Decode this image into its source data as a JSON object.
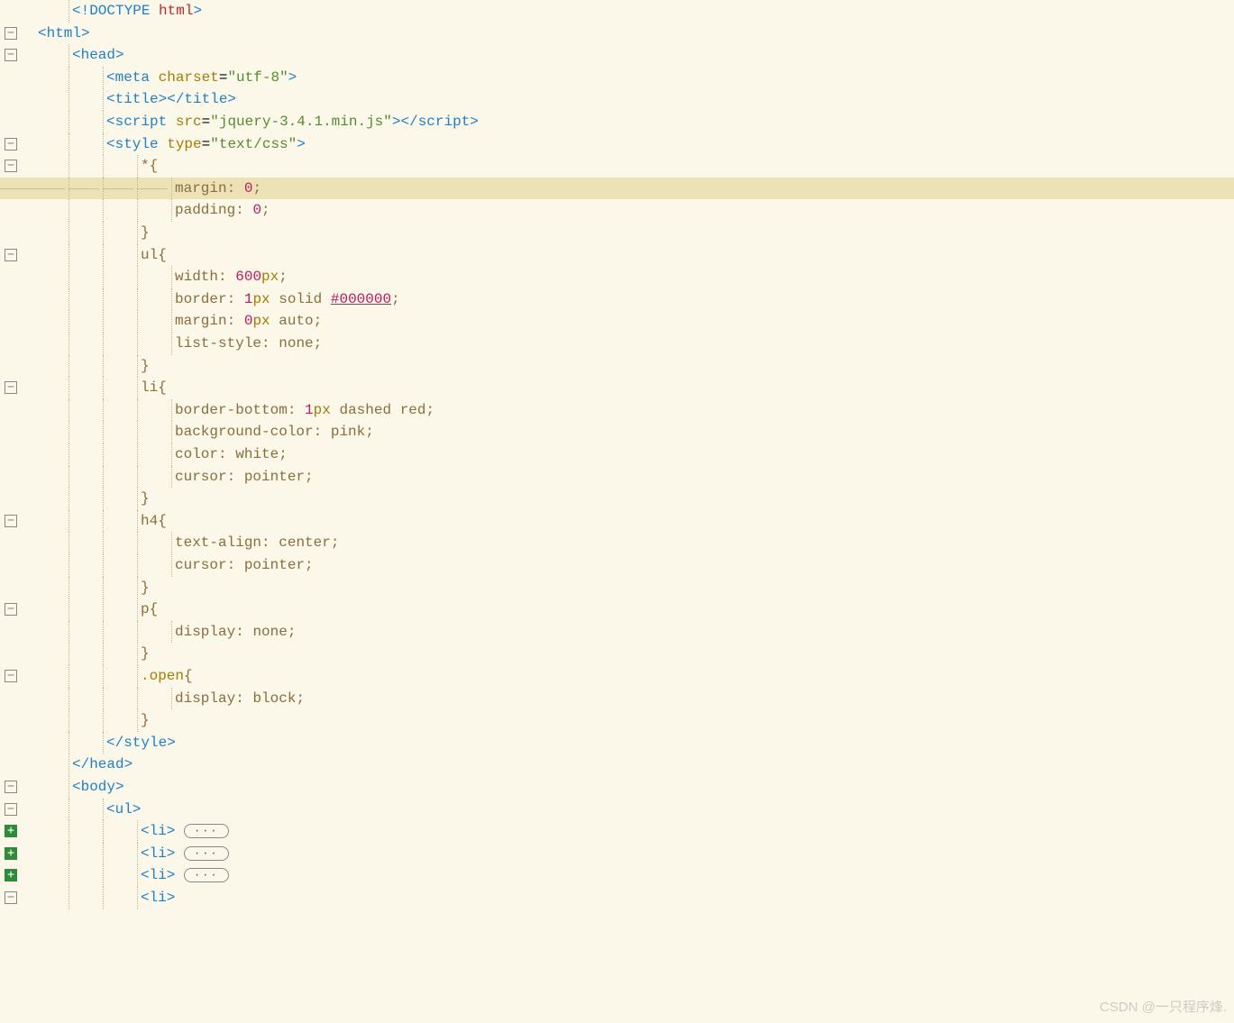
{
  "watermark": "CSDN @一只程序烽.",
  "pill": "···",
  "lines": [
    {
      "fold": null,
      "indent": 1,
      "html": "<span class='t-tag'>&lt;!DOCTYPE</span> <span class='t-red'>html</span><span class='t-tag'>&gt;</span>"
    },
    {
      "fold": "minus",
      "indent": 0,
      "html": "<span class='t-tag'>&lt;html&gt;</span>"
    },
    {
      "fold": "minus",
      "indent": 1,
      "html": "<span class='t-tag'>&lt;head&gt;</span>"
    },
    {
      "fold": null,
      "indent": 2,
      "html": "<span class='t-tag'>&lt;meta</span> <span class='t-attr'>charset</span>=<span class='t-str'>\"utf-8\"</span><span class='t-tag'>&gt;</span>"
    },
    {
      "fold": null,
      "indent": 2,
      "html": "<span class='t-tag'>&lt;title&gt;&lt;/title&gt;</span>"
    },
    {
      "fold": null,
      "indent": 2,
      "html": "<span class='t-tag'>&lt;script</span> <span class='t-attr'>src</span>=<span class='t-str'>\"jquery-3.4.1.min.js\"</span><span class='t-tag'>&gt;&lt;/script&gt;</span>"
    },
    {
      "fold": "minus",
      "indent": 2,
      "html": "<span class='t-tag'>&lt;style</span> <span class='t-attr'>type</span>=<span class='t-str'>\"text/css\"</span><span class='t-tag'>&gt;</span>"
    },
    {
      "fold": "minus",
      "indent": 3,
      "html": "<span class='t-sel'>*</span><span class='t-punc'>{</span>"
    },
    {
      "fold": null,
      "indent": 4,
      "hl": true,
      "hlguides": true,
      "html": "<span class='t-prop'>margin</span><span class='t-punc'>:</span> <span class='t-num'>0</span><span class='t-punc'>;</span>"
    },
    {
      "fold": null,
      "indent": 4,
      "html": "<span class='t-prop'>padding</span><span class='t-punc'>:</span> <span class='t-num'>0</span><span class='t-punc'>;</span>"
    },
    {
      "fold": null,
      "indent": 3,
      "html": "<span class='t-punc'>}</span>"
    },
    {
      "fold": "minus",
      "indent": 3,
      "html": "<span class='t-sel'>ul</span><span class='t-punc'>{</span>"
    },
    {
      "fold": null,
      "indent": 4,
      "html": "<span class='t-prop'>width</span><span class='t-punc'>:</span> <span class='t-num'>600</span><span class='t-kw'>px</span><span class='t-punc'>;</span>"
    },
    {
      "fold": null,
      "indent": 4,
      "html": "<span class='t-prop'>border</span><span class='t-punc'>:</span> <span class='t-num'>1</span><span class='t-kw'>px</span> <span class='t-val'>solid</span> <span class='t-hex'>#000000</span><span class='t-punc'>;</span>"
    },
    {
      "fold": null,
      "indent": 4,
      "html": "<span class='t-prop'>margin</span><span class='t-punc'>:</span> <span class='t-num'>0</span><span class='t-kw'>px</span> <span class='t-val'>auto</span><span class='t-punc'>;</span>"
    },
    {
      "fold": null,
      "indent": 4,
      "html": "<span class='t-prop'>list-style</span><span class='t-punc'>:</span> <span class='t-val'>none</span><span class='t-punc'>;</span>"
    },
    {
      "fold": null,
      "indent": 3,
      "html": "<span class='t-punc'>}</span>"
    },
    {
      "fold": "minus",
      "indent": 3,
      "html": "<span class='t-sel'>li</span><span class='t-punc'>{</span>"
    },
    {
      "fold": null,
      "indent": 4,
      "html": "<span class='t-prop'>border-bottom</span><span class='t-punc'>:</span> <span class='t-num'>1</span><span class='t-kw'>px</span> <span class='t-val'>dashed</span> <span class='t-val'>red</span><span class='t-punc'>;</span>"
    },
    {
      "fold": null,
      "indent": 4,
      "html": "<span class='t-prop'>background-color</span><span class='t-punc'>:</span> <span class='t-val'>pink</span><span class='t-punc'>;</span>"
    },
    {
      "fold": null,
      "indent": 4,
      "html": "<span class='t-prop'>color</span><span class='t-punc'>:</span> <span class='t-val'>white</span><span class='t-punc'>;</span>"
    },
    {
      "fold": null,
      "indent": 4,
      "html": "<span class='t-prop'>cursor</span><span class='t-punc'>:</span> <span class='t-val'>pointer</span><span class='t-punc'>;</span>"
    },
    {
      "fold": null,
      "indent": 3,
      "html": "<span class='t-punc'>}</span>"
    },
    {
      "fold": "minus",
      "indent": 3,
      "html": "<span class='t-sel'>h4</span><span class='t-punc'>{</span>"
    },
    {
      "fold": null,
      "indent": 4,
      "html": "<span class='t-prop'>text-align</span><span class='t-punc'>:</span> <span class='t-val'>center</span><span class='t-punc'>;</span>"
    },
    {
      "fold": null,
      "indent": 4,
      "html": "<span class='t-prop'>cursor</span><span class='t-punc'>:</span> <span class='t-val'>pointer</span><span class='t-punc'>;</span>"
    },
    {
      "fold": null,
      "indent": 3,
      "html": "<span class='t-punc'>}</span>"
    },
    {
      "fold": "minus",
      "indent": 3,
      "html": "<span class='t-sel'>p</span><span class='t-punc'>{</span>"
    },
    {
      "fold": null,
      "indent": 4,
      "html": "<span class='t-prop'>display</span><span class='t-punc'>:</span> <span class='t-val'>none</span><span class='t-punc'>;</span>"
    },
    {
      "fold": null,
      "indent": 3,
      "html": "<span class='t-punc'>}</span>"
    },
    {
      "fold": "minus",
      "indent": 3,
      "html": "<span class='t-class'>.open</span><span class='t-punc'>{</span>"
    },
    {
      "fold": null,
      "indent": 4,
      "html": "<span class='t-prop'>display</span><span class='t-punc'>:</span> <span class='t-val'>block</span><span class='t-punc'>;</span>"
    },
    {
      "fold": null,
      "indent": 3,
      "html": "<span class='t-punc'>}</span>"
    },
    {
      "fold": null,
      "indent": 2,
      "html": "<span class='t-tag'>&lt;/style&gt;</span>"
    },
    {
      "fold": null,
      "indent": 1,
      "html": "<span class='t-tag'>&lt;/head&gt;</span>"
    },
    {
      "fold": "minus",
      "indent": 1,
      "html": "<span class='t-tag'>&lt;body&gt;</span>"
    },
    {
      "fold": "minus",
      "indent": 2,
      "html": "<span class='t-tag'>&lt;ul&gt;</span>"
    },
    {
      "fold": "plus",
      "indent": 3,
      "html": "<span class='t-tag'>&lt;li&gt;</span> <span class='fold-pill' data-name='folded-code-pill' data-interactable='true' data-bind='pill'></span>"
    },
    {
      "fold": "plus",
      "indent": 3,
      "html": "<span class='t-tag'>&lt;li&gt;</span> <span class='fold-pill' data-name='folded-code-pill' data-interactable='true' data-bind='pill'></span>"
    },
    {
      "fold": "plus",
      "indent": 3,
      "html": "<span class='t-tag'>&lt;li&gt;</span> <span class='fold-pill' data-name='folded-code-pill' data-interactable='true' data-bind='pill'></span>"
    },
    {
      "fold": "minus",
      "indent": 3,
      "html": "<span class='t-tag'>&lt;li&gt;</span>"
    }
  ]
}
